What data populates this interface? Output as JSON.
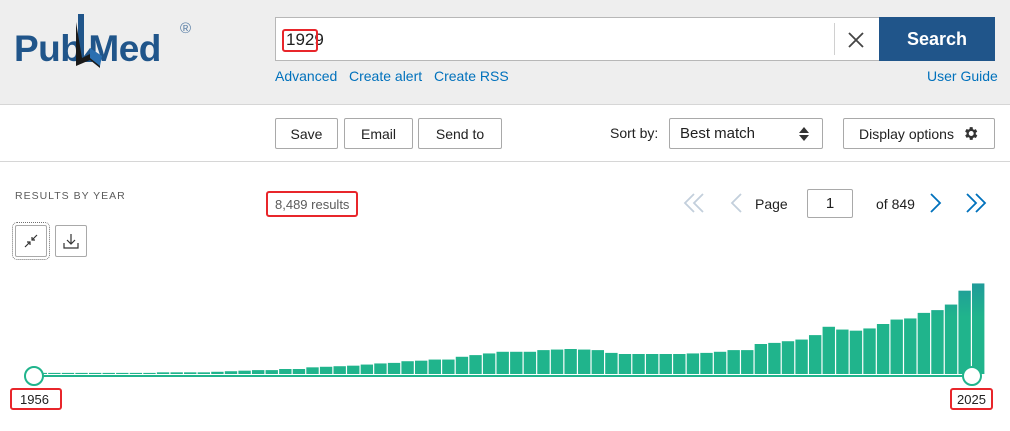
{
  "header": {
    "logo_pub": "Pub",
    "logo_med": "Med",
    "logo_reg": "®",
    "search_value": "1929",
    "search_button": "Search",
    "links": {
      "advanced": "Advanced",
      "create_alert": "Create alert",
      "create_rss": "Create RSS",
      "user_guide": "User Guide"
    }
  },
  "toolbar": {
    "save": "Save",
    "email": "Email",
    "send_to": "Send to",
    "sort_label": "Sort by:",
    "sort_value": "Best match",
    "display_options": "Display options"
  },
  "results": {
    "section_label": "RESULTS BY YEAR",
    "count": "8,489 results"
  },
  "pager": {
    "page_label": "Page",
    "page_value": "1",
    "of_label": "of 849"
  },
  "timeline": {
    "start_year": "1956",
    "end_year": "2025"
  },
  "chart_data": {
    "type": "bar",
    "xlabel": "",
    "ylabel": "",
    "x_range": [
      1956,
      2025
    ],
    "ylim": [
      0,
      270
    ],
    "years": [
      1956,
      1957,
      1958,
      1959,
      1960,
      1961,
      1962,
      1963,
      1964,
      1965,
      1966,
      1967,
      1968,
      1969,
      1970,
      1971,
      1972,
      1973,
      1974,
      1975,
      1976,
      1977,
      1978,
      1979,
      1980,
      1981,
      1982,
      1983,
      1984,
      1985,
      1986,
      1987,
      1988,
      1989,
      1990,
      1991,
      1992,
      1993,
      1994,
      1995,
      1996,
      1997,
      1998,
      1999,
      2000,
      2001,
      2002,
      2003,
      2004,
      2005,
      2006,
      2007,
      2008,
      2009,
      2010,
      2011,
      2012,
      2013,
      2014,
      2015,
      2016,
      2017,
      2018,
      2019,
      2020,
      2021,
      2022,
      2023,
      2024,
      2025
    ],
    "values": [
      2,
      2,
      2,
      2,
      2,
      2,
      2,
      2,
      2,
      3,
      3,
      3,
      3,
      4,
      5,
      6,
      7,
      7,
      9,
      9,
      12,
      13,
      14,
      15,
      17,
      19,
      20,
      23,
      24,
      26,
      26,
      31,
      34,
      37,
      40,
      40,
      40,
      43,
      44,
      45,
      44,
      43,
      38,
      36,
      36,
      36,
      36,
      36,
      37,
      38,
      40,
      43,
      43,
      54,
      56,
      59,
      62,
      70,
      85,
      80,
      78,
      82,
      90,
      98,
      100,
      110,
      115,
      125,
      150,
      163
    ]
  },
  "colors": {
    "brand": "#20558a",
    "link": "#0071bc",
    "bar_low": "#20b48c",
    "bar_high": "#1f6fb2",
    "highlight": "#e8262b"
  }
}
